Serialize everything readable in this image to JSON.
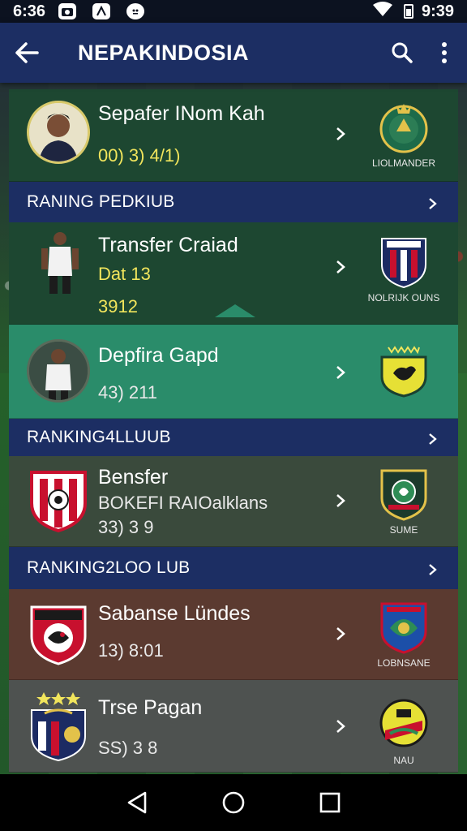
{
  "status_bar": {
    "time": "6:36",
    "clock": "9:39",
    "icons": [
      "camera-icon",
      "game-icon",
      "notification-icon",
      "wifi-icon",
      "battery-icon"
    ]
  },
  "app_bar": {
    "title": "NEPAKINDOSIA",
    "icons": [
      "back-arrow-icon",
      "search-icon",
      "more-vert-icon"
    ]
  },
  "cards": [
    {
      "name": "Sepafer INom Kah",
      "line2": "",
      "stat": "00) 3) 4/1)",
      "club": "LIOLMANDER"
    },
    {
      "section": "RANING PEDKIUB"
    },
    {
      "name": "Transfer Craiad",
      "line2": "Dat 13",
      "stat": "3912",
      "club": "NOLRIJK OUNS"
    },
    {
      "name": "Depfira Gapd",
      "line2": "",
      "stat": "43) 211",
      "club": ""
    },
    {
      "section": "RANKING4LLUUB"
    },
    {
      "name": "Bensfer",
      "line2": "BOKEFI RAIOalklans",
      "stat": "33) 3 9",
      "club": "SUME"
    },
    {
      "section": "RANKING2LOO LUB"
    },
    {
      "name": "Sabanse Lündes",
      "line2": "",
      "stat": "13) 8:01",
      "club": "LOBNSANE"
    },
    {
      "name": "Trse Pagan",
      "line2": "",
      "stat": "SS) 3 8",
      "club": "NAU"
    }
  ],
  "colors": {
    "app_bar": "#1c2e63",
    "card_green_dark": "#1d4731",
    "card_teal": "#2a8c6a",
    "card_olive": "#3a4a3c",
    "card_brown": "#5b3a30",
    "card_grey": "#4e5250",
    "highlight_yellow": "#f1e55c"
  },
  "nav_bar": {
    "icons": [
      "back-triangle-icon",
      "home-circle-icon",
      "recents-square-icon"
    ]
  }
}
